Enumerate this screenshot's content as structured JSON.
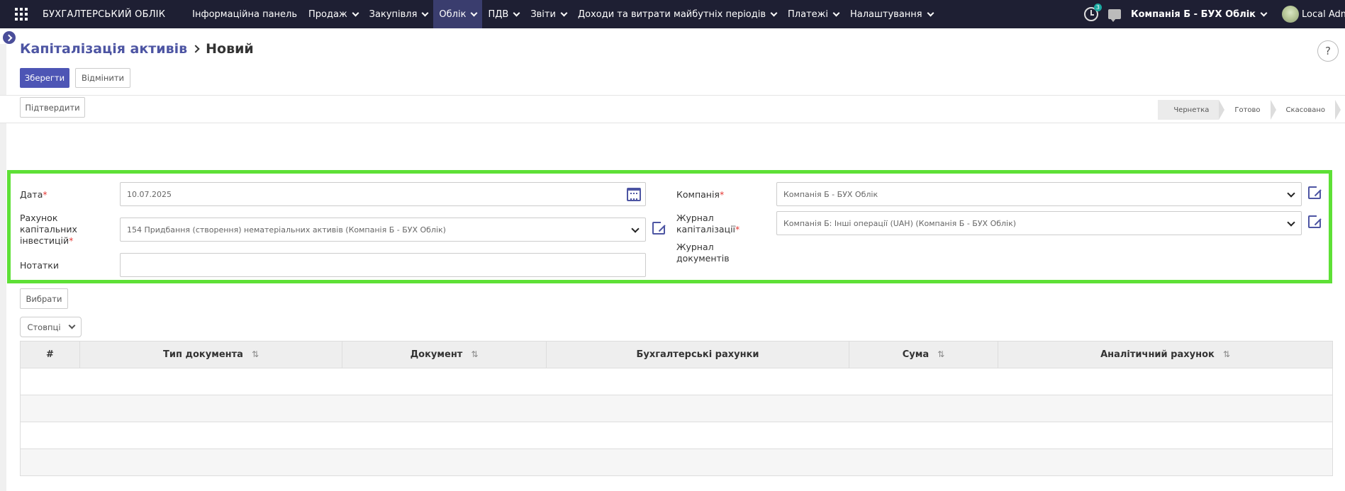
{
  "app": {
    "brand": "БУХГАЛТЕРСЬКИЙ ОБЛІК",
    "menu": [
      {
        "label": "Інформаційна панель",
        "dropdown": false,
        "active": false
      },
      {
        "label": "Продаж",
        "dropdown": true,
        "active": false
      },
      {
        "label": "Закупівля",
        "dropdown": true,
        "active": false
      },
      {
        "label": "Облік",
        "dropdown": true,
        "active": true
      },
      {
        "label": "ПДВ",
        "dropdown": true,
        "active": false
      },
      {
        "label": "Звіти",
        "dropdown": true,
        "active": false
      },
      {
        "label": "Доходи та витрати майбутніх періодів",
        "dropdown": true,
        "active": false
      },
      {
        "label": "Платежі",
        "dropdown": true,
        "active": false
      },
      {
        "label": "Налаштування",
        "dropdown": true,
        "active": false
      }
    ],
    "activity_count": "3",
    "company": "Компанія Б - БУХ Облік",
    "user": "Local Admin"
  },
  "breadcrumb": {
    "parent": "Капіталізація активів",
    "current": "Новий"
  },
  "buttons": {
    "save": "Зберегти",
    "discard": "Відмінити",
    "confirm": "Підтвердити",
    "select": "Вибрати",
    "columns": "Стовпці",
    "help": "?"
  },
  "status": {
    "stages": [
      "Чернетка",
      "Готово",
      "Скасовано"
    ],
    "current": "Чернетка"
  },
  "form": {
    "date_label": "Дата",
    "date_value": "10.07.2025",
    "account_label_1": "Рахунок",
    "account_label_2": "капітальних",
    "account_label_3": "інвестицій",
    "account_value": "154 Придбання (створення) нематеріальних активів (Компанія Б - БУХ Облік)",
    "notes_label": "Нотатки",
    "notes_value": "",
    "company_label": "Компанія",
    "company_value": "Компанія Б - БУХ Облік",
    "journal_label_1": "Журнал",
    "journal_label_2": "капіталізації",
    "journal_value": "Компанія Б: Інші операції (UAH) (Компанія Б - БУХ Облік)",
    "doc_journal_label_1": "Журнал",
    "doc_journal_label_2": "документів"
  },
  "table": {
    "headers": {
      "num": "#",
      "doc_type": "Тип документа",
      "doc": "Документ",
      "accounts": "Бухгалтерські рахунки",
      "amount": "Сума",
      "analytic": "Аналітичний рахунок"
    },
    "empty_rows": 4
  },
  "colors": {
    "topbar": "#1e1f33",
    "accent": "#4d55b5",
    "highlight": "#5ee036"
  }
}
